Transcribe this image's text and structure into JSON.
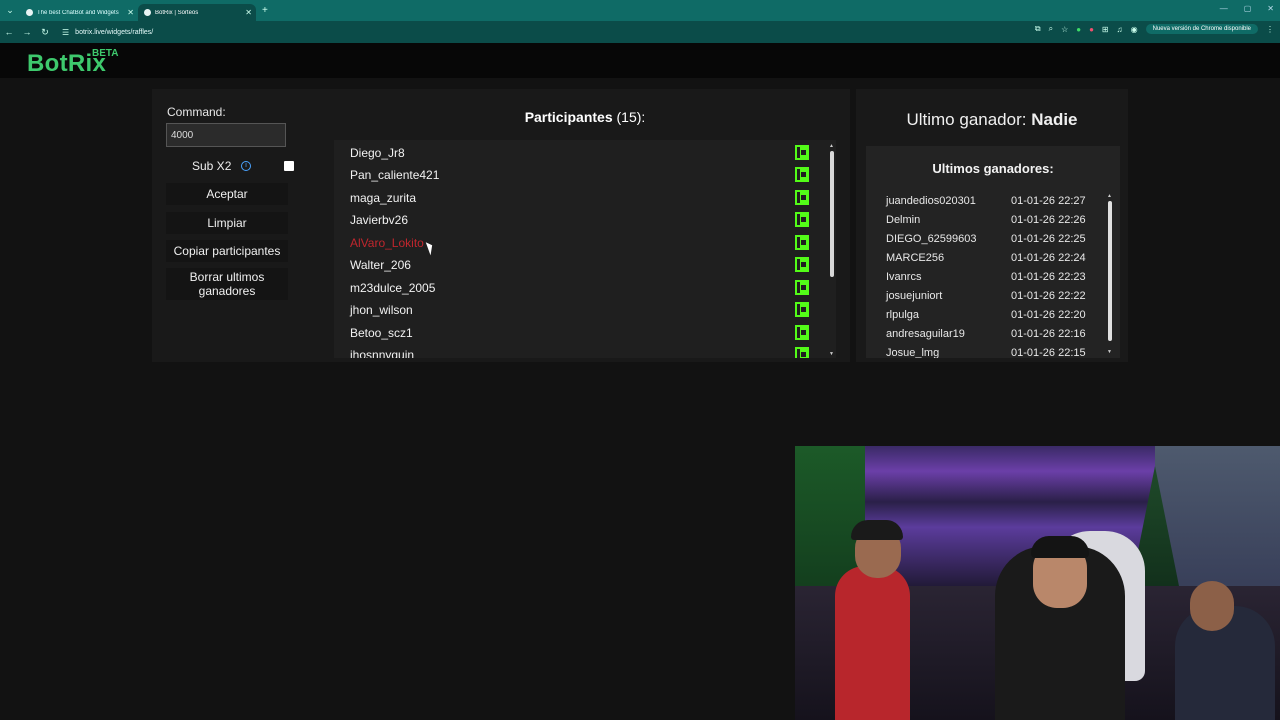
{
  "browser": {
    "tabs": [
      {
        "title": "The best ChatBot and Widgets"
      },
      {
        "title": "BotRix | Sorteos"
      }
    ],
    "url": "botrix.live/widgets/raffles/",
    "update_label": "Nueva versión de Chrome disponible"
  },
  "app": {
    "logo": "BotRix",
    "beta": "BETA"
  },
  "controls": {
    "command_label": "Command:",
    "command_value": "4000",
    "sub_label": "Sub X2",
    "info_glyph": "i",
    "aceptar": "Aceptar",
    "limpiar": "Limpiar",
    "copiar": "Copiar participantes",
    "borrar": "Borrar ultimos ganadores"
  },
  "participants": {
    "title": "Participantes",
    "count": "(15):",
    "items": [
      {
        "name": "Diego_Jr8"
      },
      {
        "name": "Pan_caliente421"
      },
      {
        "name": "maga_zurita"
      },
      {
        "name": "Javierbv26"
      },
      {
        "name": "AlVaro_Lokito"
      },
      {
        "name": "Walter_206"
      },
      {
        "name": "m23dulce_2005"
      },
      {
        "name": "jhon_wilson"
      },
      {
        "name": "Betoo_scz1"
      },
      {
        "name": "jhosnnyquin"
      }
    ]
  },
  "winner": {
    "label": "Ultimo ganador:",
    "name": "Nadie"
  },
  "last_winners": {
    "title": "Ultimos ganadores:",
    "items": [
      {
        "name": "juandedios020301",
        "date": "01-01-26 22:27"
      },
      {
        "name": "Delmin",
        "date": "01-01-26 22:26"
      },
      {
        "name": "DIEGO_62599603",
        "date": "01-01-26 22:25"
      },
      {
        "name": "MARCE256",
        "date": "01-01-26 22:24"
      },
      {
        "name": "Ivanrcs",
        "date": "01-01-26 22:23"
      },
      {
        "name": "josuejuniort",
        "date": "01-01-26 22:22"
      },
      {
        "name": "rlpulga",
        "date": "01-01-26 22:20"
      },
      {
        "name": "andresaguilar19",
        "date": "01-01-26 22:16"
      },
      {
        "name": "Josue_lmg",
        "date": "01-01-26 22:15"
      }
    ]
  },
  "colors": {
    "brand": "#3ec96d",
    "kick": "#53fc18",
    "hover_name": "#c0262d"
  }
}
